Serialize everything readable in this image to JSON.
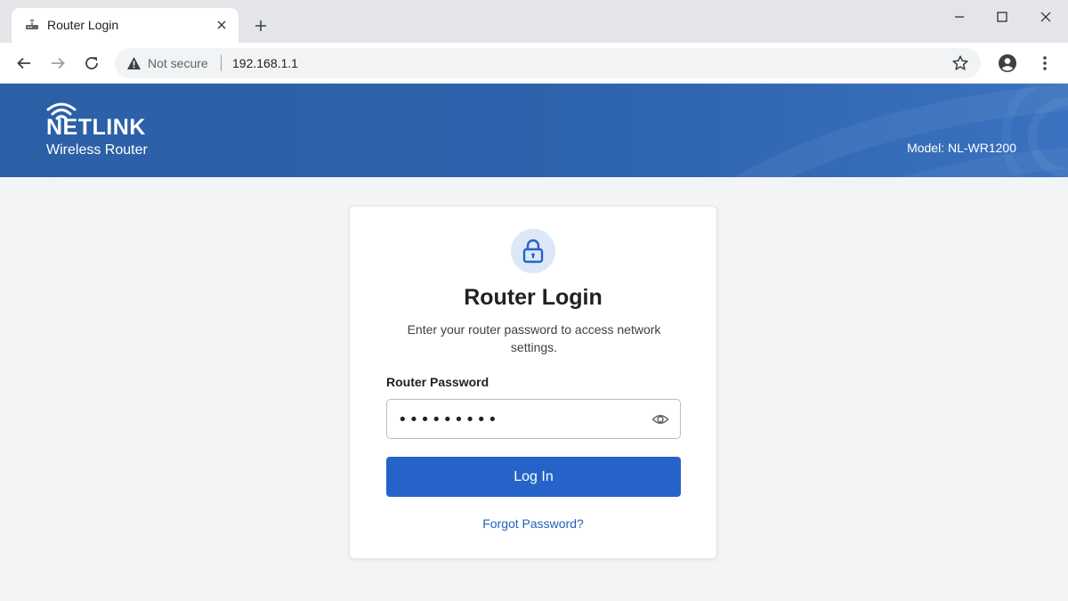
{
  "browser": {
    "tab_title": "Router Login",
    "security_label": "Not secure",
    "url": "192.168.1.1",
    "icons": {
      "favicon": "router-icon",
      "tab_close": "close-icon",
      "new_tab": "plus-icon",
      "minimize": "minimize-icon",
      "maximize": "maximize-icon",
      "close": "close-icon",
      "back": "arrow-left-icon",
      "forward": "arrow-right-icon",
      "reload": "reload-icon",
      "warning": "warning-icon",
      "bookmark": "star-icon",
      "profile": "account-icon",
      "menu": "kebab-menu-icon"
    }
  },
  "header": {
    "brand": "NETLINK",
    "subtitle": "Wireless Router",
    "model": "Model: NL-WR1200"
  },
  "login": {
    "title": "Router Login",
    "description": "Enter your router password to access network settings.",
    "password_label": "Router Password",
    "password_value": "•••••••••",
    "submit_label": "Log In",
    "forgot_label": "Forgot Password?"
  },
  "colors": {
    "header_bg": "#2e63ad",
    "button_bg": "#2563c9",
    "link": "#1f61b8",
    "lock_bg": "#dde8f6"
  }
}
